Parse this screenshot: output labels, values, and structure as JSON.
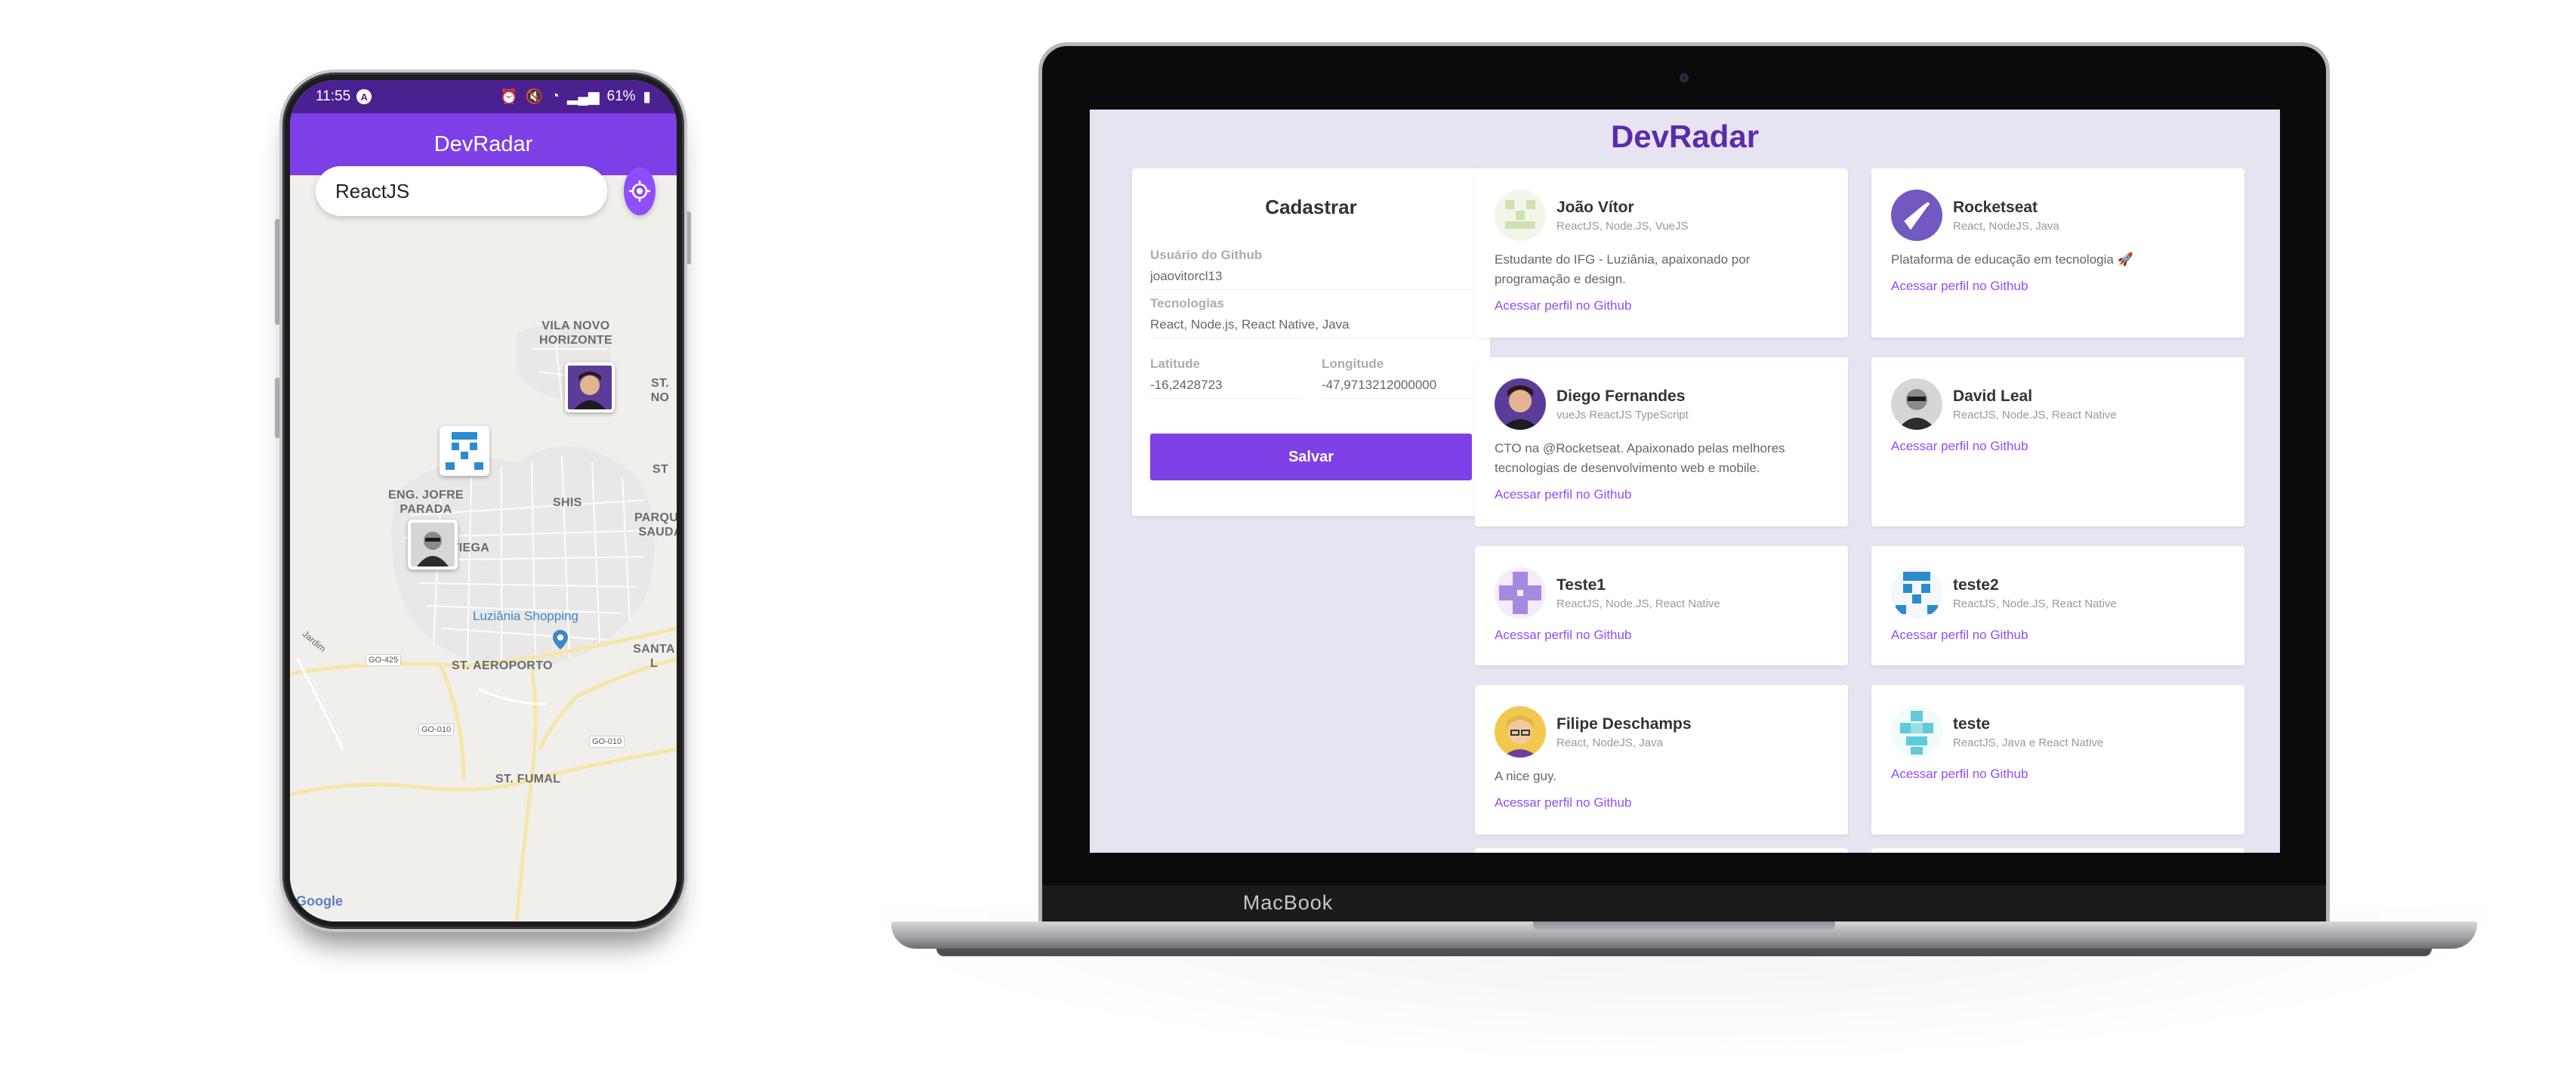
{
  "phone": {
    "status_time": "11:55",
    "status_app_icon": "A",
    "status_battery": "61%",
    "app_title": "DevRadar",
    "search": {
      "value": "ReactJS"
    },
    "map_labels": {
      "vila_novo": "VILA NOVO",
      "horizonte": "HORIZONTE",
      "st_no": "ST. NO",
      "eng_jofre": "ENG. JOFRE",
      "parada": "PARADA",
      "shis": "SHIS",
      "st_cut": "ST",
      "parque": "PARQUE",
      "saudade": "SAUDA",
      "st_viega": "ST. VIEGA",
      "santa": "SANTA L",
      "st_aeroporto": "ST. AEROPORTO",
      "st_fumal": "ST. FUMAL",
      "go425": "GO-425",
      "go010a": "GO-010",
      "go010b": "GO-010",
      "jardim": "Jardim",
      "poi_shopping": "Luziânia Shopping",
      "google": "Google"
    }
  },
  "laptop": {
    "brand": "MacBook",
    "page_title": "DevRadar",
    "form": {
      "title": "Cadastrar",
      "github_label": "Usuário do Github",
      "github_value": "joaovitorcl13",
      "techs_label": "Tecnologias",
      "techs_value": "React, Node.js, React Native, Java",
      "lat_label": "Latitude",
      "lat_value": "-16,2428723",
      "lon_label": "Longitude",
      "lon_value": "-47,9713212000000",
      "submit": "Salvar"
    },
    "devs": [
      {
        "name": "João Vítor",
        "techs": "ReactJS, Node.JS, VueJS",
        "bio": "Estudante do IFG - Luziânia, apaixonado por programação e design.",
        "link": "Acessar perfil no Github"
      },
      {
        "name": "Rocketseat",
        "techs": "React, NodeJS, Java",
        "bio": "Plataforma de educação em tecnologia 🚀",
        "link": "Acessar perfil no Github"
      },
      {
        "name": "Diego Fernandes",
        "techs": "vueJs ReactJS TypeScript",
        "bio": "CTO na @Rocketseat. Apaixonado pelas melhores tecnologias de desenvolvimento web e mobile.",
        "link": "Acessar perfil no Github"
      },
      {
        "name": "David Leal",
        "techs": "ReactJS, Node.JS, React Native",
        "bio": "",
        "link": "Acessar perfil no Github"
      },
      {
        "name": "Teste1",
        "techs": "ReactJS, Node.JS, React Native",
        "bio": "",
        "link": "Acessar perfil no Github"
      },
      {
        "name": "teste2",
        "techs": "ReactJS, Node.JS, React Native",
        "bio": "",
        "link": "Acessar perfil no Github"
      },
      {
        "name": "Filipe Deschamps",
        "techs": "React, NodeJS, Java",
        "bio": "A nice guy.",
        "link": "Acessar perfil no Github"
      },
      {
        "name": "teste",
        "techs": "ReactJS, Java e React Native",
        "bio": "",
        "link": "Acessar perfil no Github"
      }
    ]
  },
  "colors": {
    "primary": "#7d40e7",
    "primary_light": "#8e4dff",
    "title": "#5a2cad",
    "page_bg": "#e6e4f0",
    "status_bar": "#4b2191"
  },
  "icons": {
    "location": "my-location-icon",
    "camera": "camera-icon",
    "map_pin": "map-pin-icon"
  }
}
